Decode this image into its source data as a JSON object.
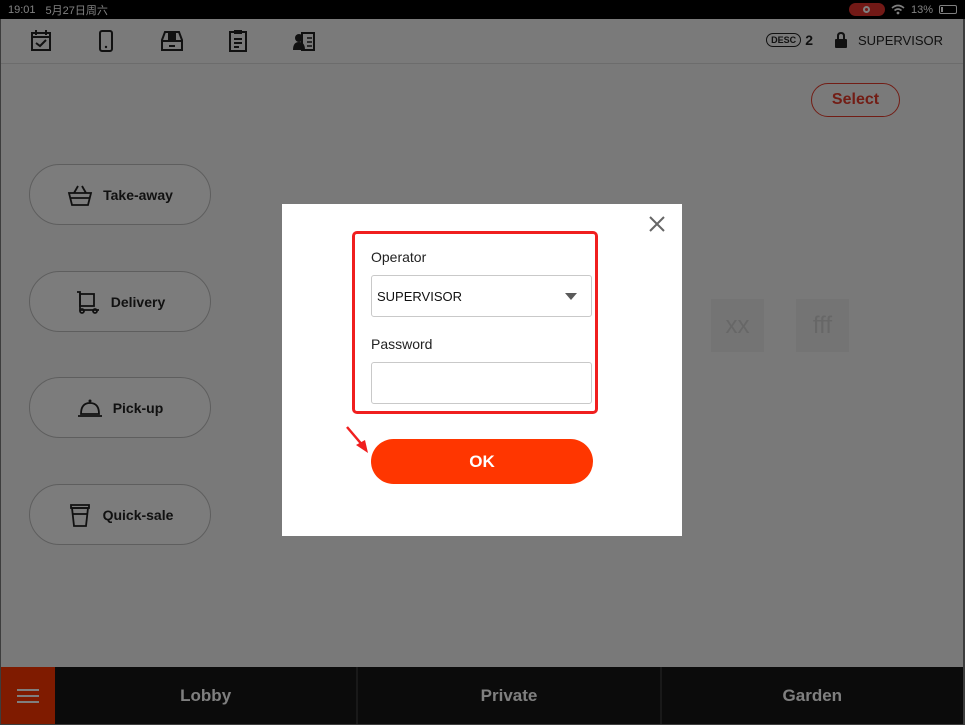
{
  "status": {
    "time": "19:01",
    "date": "5月27日周六",
    "battery": "13%",
    "battery_fraction": 0.13
  },
  "toolbar": {
    "icons": [
      "calendar-check-icon",
      "tablet-icon",
      "cash-drawer-icon",
      "clipboard-icon",
      "user-card-icon"
    ],
    "desc_label": "DESC",
    "desc_count": "2",
    "user": "SUPERVISOR"
  },
  "main": {
    "select_label": "Select",
    "order_types": [
      {
        "label": "Take-away",
        "icon": "basket-icon"
      },
      {
        "label": "Delivery",
        "icon": "delivery-cart-icon"
      },
      {
        "label": "Pick-up",
        "icon": "service-bell-icon"
      },
      {
        "label": "Quick-sale",
        "icon": "cup-icon"
      }
    ],
    "tables": [
      "xx",
      "fff"
    ]
  },
  "bottom_tabs": [
    "Lobby",
    "Private",
    "Garden"
  ],
  "login_dialog": {
    "operator_label": "Operator",
    "operator_value": "SUPERVISOR",
    "password_label": "Password",
    "password_value": "",
    "ok_label": "OK"
  },
  "colors": {
    "accent": "#FF3600",
    "highlight": "#F01F1F",
    "overlay": "rgba(0,0,0,0.5)"
  }
}
